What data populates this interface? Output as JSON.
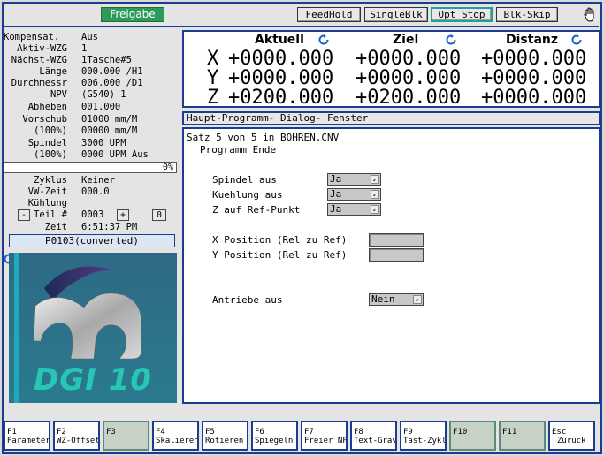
{
  "toolbar": {
    "freigabe": "Freigabe",
    "feedhold": "FeedHold",
    "singleblk": "SingleBlk",
    "optstop": "Opt Stop",
    "blkskip": "Blk-Skip"
  },
  "status": {
    "rows": [
      {
        "label": "Kompensat.",
        "value": "Aus"
      },
      {
        "label": "Aktiv-WZG",
        "value": "1"
      },
      {
        "label": "Nächst-WZG",
        "value": "1Tasche#5"
      },
      {
        "label": "Länge",
        "value": "000.000 /H1"
      },
      {
        "label": "Durchmessr",
        "value": "006.000 /D1"
      },
      {
        "label": "NPV",
        "value": "(G540) 1"
      },
      {
        "label": "Abheben",
        "value": "001.000"
      },
      {
        "label": "Vorschub",
        "value": "01000 mm/M"
      },
      {
        "label": "(100%)",
        "value": "00000 mm/M"
      },
      {
        "label": "Spindel",
        "value": "3000 UPM"
      },
      {
        "label": "(100%)",
        "value": "0000 UPM Aus"
      }
    ],
    "progress_pct": "0%",
    "progress_value": 0,
    "rows2": [
      {
        "label": "Zyklus",
        "value": "Keiner"
      },
      {
        "label": "VW-Zeit",
        "value": "000.0"
      },
      {
        "label": "Kühlung",
        "value": ""
      }
    ],
    "teil": {
      "minus": "-",
      "label": "Teil #",
      "value": "0003",
      "plus": "+",
      "count": "0"
    },
    "zeit": {
      "label": "Zeit",
      "value": "6:51:37 PM"
    },
    "program_name": "P0103(converted)",
    "logo_text": "DGI 10"
  },
  "axes": {
    "headers": {
      "actual": "Aktuell",
      "target": "Ziel",
      "distance": "Distanz"
    },
    "rows": [
      {
        "axis": "X",
        "actual": "+0000.000",
        "target": "+0000.000",
        "distance": "+0000.000"
      },
      {
        "axis": "Y",
        "actual": "+0000.000",
        "target": "+0000.000",
        "distance": "+0000.000"
      },
      {
        "axis": "Z",
        "actual": "+0200.000",
        "target": "+0200.000",
        "distance": "+0000.000"
      }
    ]
  },
  "program": {
    "tabs": "Haupt-Programm-  Dialog- Fenster",
    "line1": "Satz 5 von 5 in BOHREN.CNV",
    "line2": "Programm Ende",
    "spindle_label": "Spindel aus",
    "spindle_value": "Ja",
    "coolant_label": "Kuehlung aus",
    "coolant_value": "Ja",
    "zref_label": "Z auf Ref-Punkt",
    "zref_value": "Ja",
    "xpos_label": "X Position (Rel zu Ref)",
    "ypos_label": "Y Position (Rel zu Ref)",
    "drives_label": "Antriebe aus",
    "drives_value": "Nein"
  },
  "fkeys": [
    {
      "key": "F1",
      "label": "Parameter",
      "enabled": true
    },
    {
      "key": "F2",
      "label": "WZ-Offset",
      "enabled": true
    },
    {
      "key": "F3",
      "label": "",
      "enabled": false
    },
    {
      "key": "F4",
      "label": "Skalieren",
      "enabled": true
    },
    {
      "key": "F5",
      "label": "Rotieren",
      "enabled": true
    },
    {
      "key": "F6",
      "label": "Spiegeln",
      "enabled": true
    },
    {
      "key": "F7",
      "label": "Freier NP",
      "enabled": true
    },
    {
      "key": "F8",
      "label": "Text-Grav",
      "enabled": true
    },
    {
      "key": "F9",
      "label": "Tast-Zykl",
      "enabled": true
    },
    {
      "key": "F10",
      "label": "",
      "enabled": false
    },
    {
      "key": "F11",
      "label": "",
      "enabled": false
    },
    {
      "key": "Esc",
      "label": "Zurück",
      "enabled": true
    }
  ]
}
